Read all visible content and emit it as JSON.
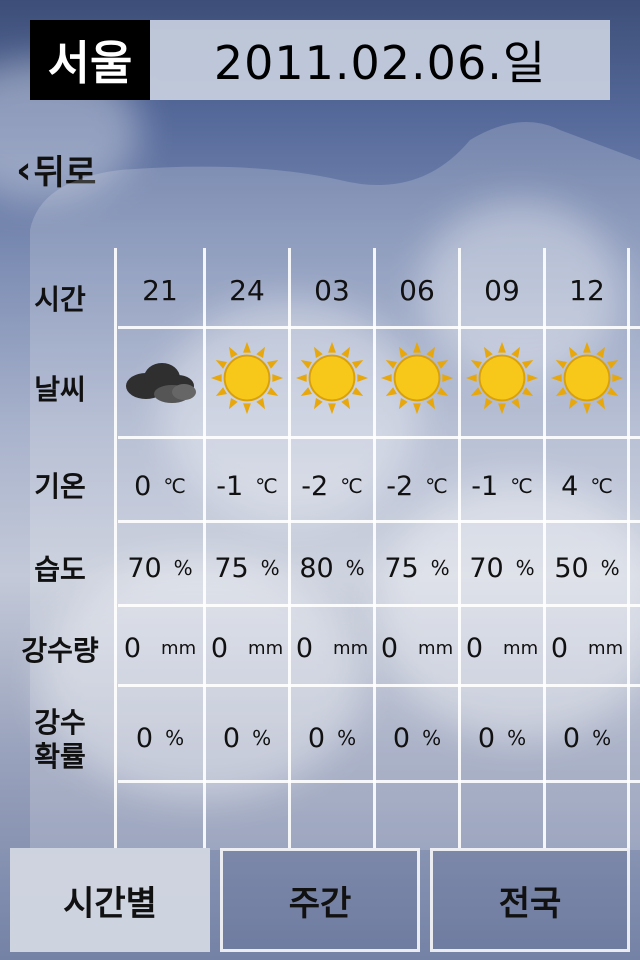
{
  "header": {
    "city": "서울",
    "date": "2011.02.06.일"
  },
  "nav": {
    "back_label": "뒤로",
    "back_icon": "chevron-left-icon"
  },
  "row_labels": {
    "time": "시간",
    "weather": "날씨",
    "temperature": "기온",
    "humidity": "습도",
    "precipitation": "강수량",
    "precip_prob_line1": "강수",
    "precip_prob_line2": "확률"
  },
  "units": {
    "temp": "℃",
    "percent": "%",
    "mm": "mm"
  },
  "forecast": [
    {
      "time": "21",
      "weather": "cloudy",
      "temp": "0",
      "humidity": "70",
      "precip": "0",
      "prob": "0"
    },
    {
      "time": "24",
      "weather": "sunny",
      "temp": "-1",
      "humidity": "75",
      "precip": "0",
      "prob": "0"
    },
    {
      "time": "03",
      "weather": "sunny",
      "temp": "-2",
      "humidity": "80",
      "precip": "0",
      "prob": "0"
    },
    {
      "time": "06",
      "weather": "sunny",
      "temp": "-2",
      "humidity": "75",
      "precip": "0",
      "prob": "0"
    },
    {
      "time": "09",
      "weather": "sunny",
      "temp": "-1",
      "humidity": "70",
      "precip": "0",
      "prob": "0"
    },
    {
      "time": "12",
      "weather": "sunny",
      "temp": "4",
      "humidity": "50",
      "precip": "0",
      "prob": "0"
    }
  ],
  "tabs": [
    {
      "label": "시간별",
      "active": true
    },
    {
      "label": "주간",
      "active": false
    },
    {
      "label": "전국",
      "active": false
    }
  ],
  "colors": {
    "sun": "#f7c81a",
    "sun_ray": "#e8a70a",
    "cloud": "#2f2f2f",
    "header_bg": "#000000"
  }
}
